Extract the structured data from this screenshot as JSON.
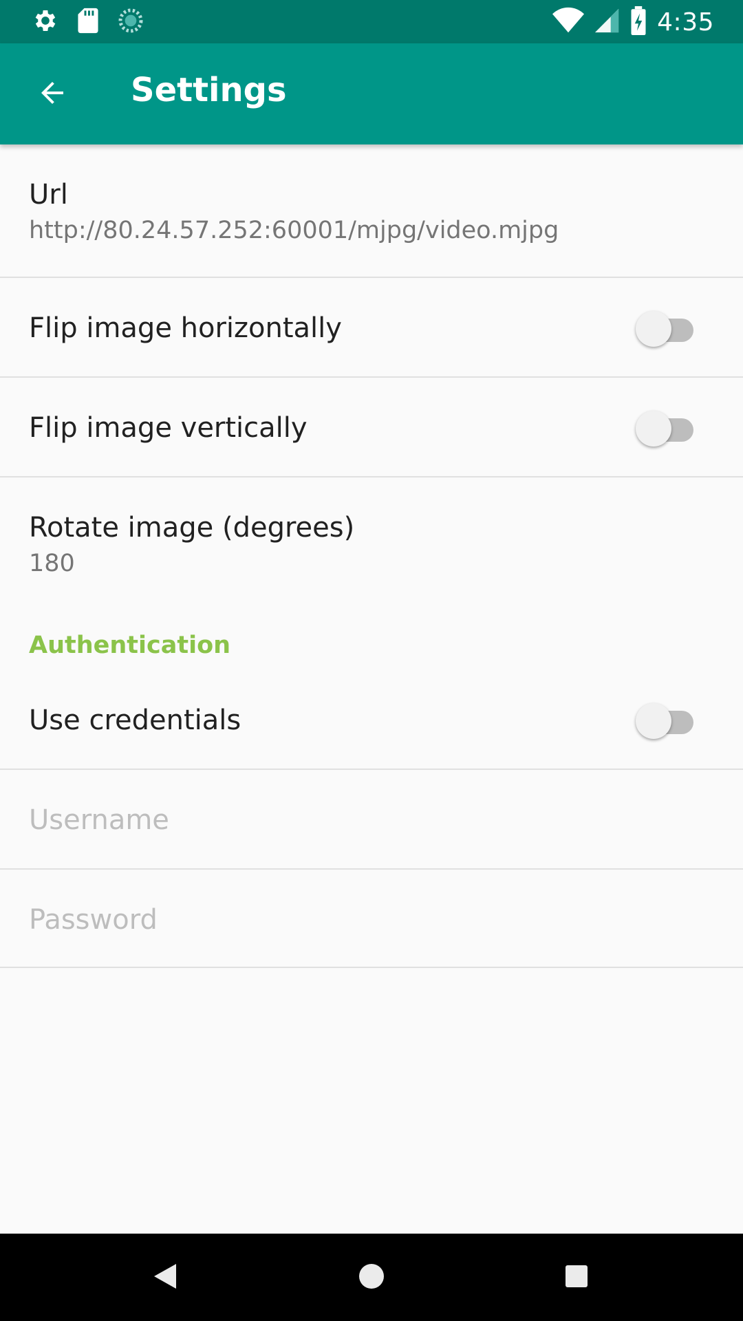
{
  "status_bar": {
    "time": "4:35",
    "icons_left": [
      "settings-icon",
      "sd-card-icon",
      "sync-icon"
    ],
    "icons_right": [
      "wifi-icon",
      "cell-signal-icon",
      "battery-charging-icon"
    ]
  },
  "toolbar": {
    "title": "Settings",
    "back_icon": "arrow-back-icon"
  },
  "settings": {
    "url": {
      "title": "Url",
      "value": "http://80.24.57.252:60001/mjpg/video.mjpg"
    },
    "flip_horizontal": {
      "title": "Flip image horizontally",
      "enabled": false
    },
    "flip_vertical": {
      "title": "Flip image vertically",
      "enabled": false
    },
    "rotate": {
      "title": "Rotate image (degrees)",
      "value": "180"
    }
  },
  "authentication": {
    "header": "Authentication",
    "use_credentials": {
      "title": "Use credentials",
      "enabled": false
    },
    "username": {
      "title": "Username"
    },
    "password": {
      "title": "Password"
    }
  },
  "colors": {
    "status_bar": "#00796b",
    "toolbar": "#009688",
    "accent": "#8bc34a",
    "background": "#fafafa"
  },
  "nav_bar": {
    "buttons": [
      "back-triangle-icon",
      "home-circle-icon",
      "recents-square-icon"
    ]
  }
}
